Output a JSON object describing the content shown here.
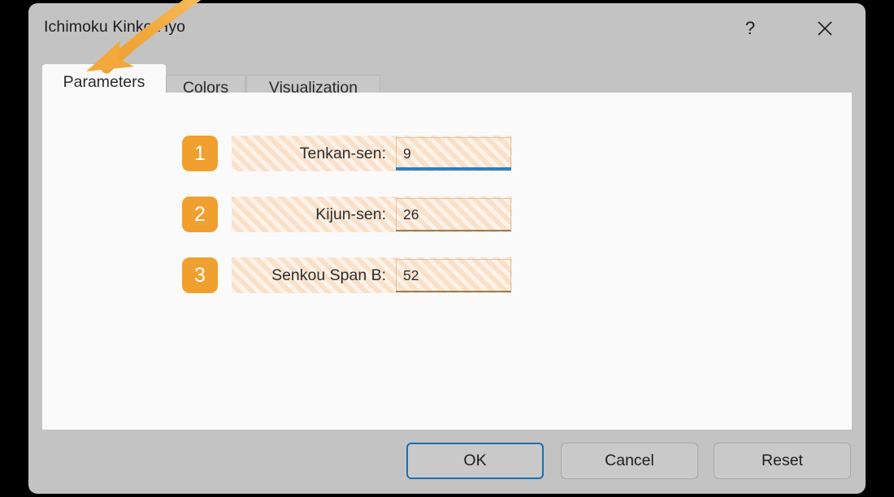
{
  "window": {
    "title": "Ichimoku Kinko Hyo",
    "help_icon": "question-mark-icon",
    "close_icon": "close-x-icon"
  },
  "tabs": [
    {
      "label": "Parameters",
      "active": true
    },
    {
      "label": "Colors",
      "active": false
    },
    {
      "label": "Visualization",
      "active": false
    }
  ],
  "parameters": [
    {
      "step": "1",
      "label": "Tenkan-sen:",
      "value": "9",
      "focused": true
    },
    {
      "step": "2",
      "label": "Kijun-sen:",
      "value": "26",
      "focused": false
    },
    {
      "step": "3",
      "label": "Senkou Span B:",
      "value": "52",
      "focused": false
    }
  ],
  "buttons": {
    "ok": "OK",
    "cancel": "Cancel",
    "reset": "Reset"
  },
  "annotation": {
    "arrow_icon": "curved-arrow-icon",
    "points_to": "Parameters"
  },
  "colors": {
    "accent_orange": "#f0a02e",
    "focus_blue": "#2f7fba",
    "primary_border_blue": "#1a6fb4",
    "chrome_gray": "#c3c3c3",
    "panel_white": "#fafafa",
    "highlight_peach": "#fae0c8",
    "annotation_orange": "#f2a83c"
  }
}
